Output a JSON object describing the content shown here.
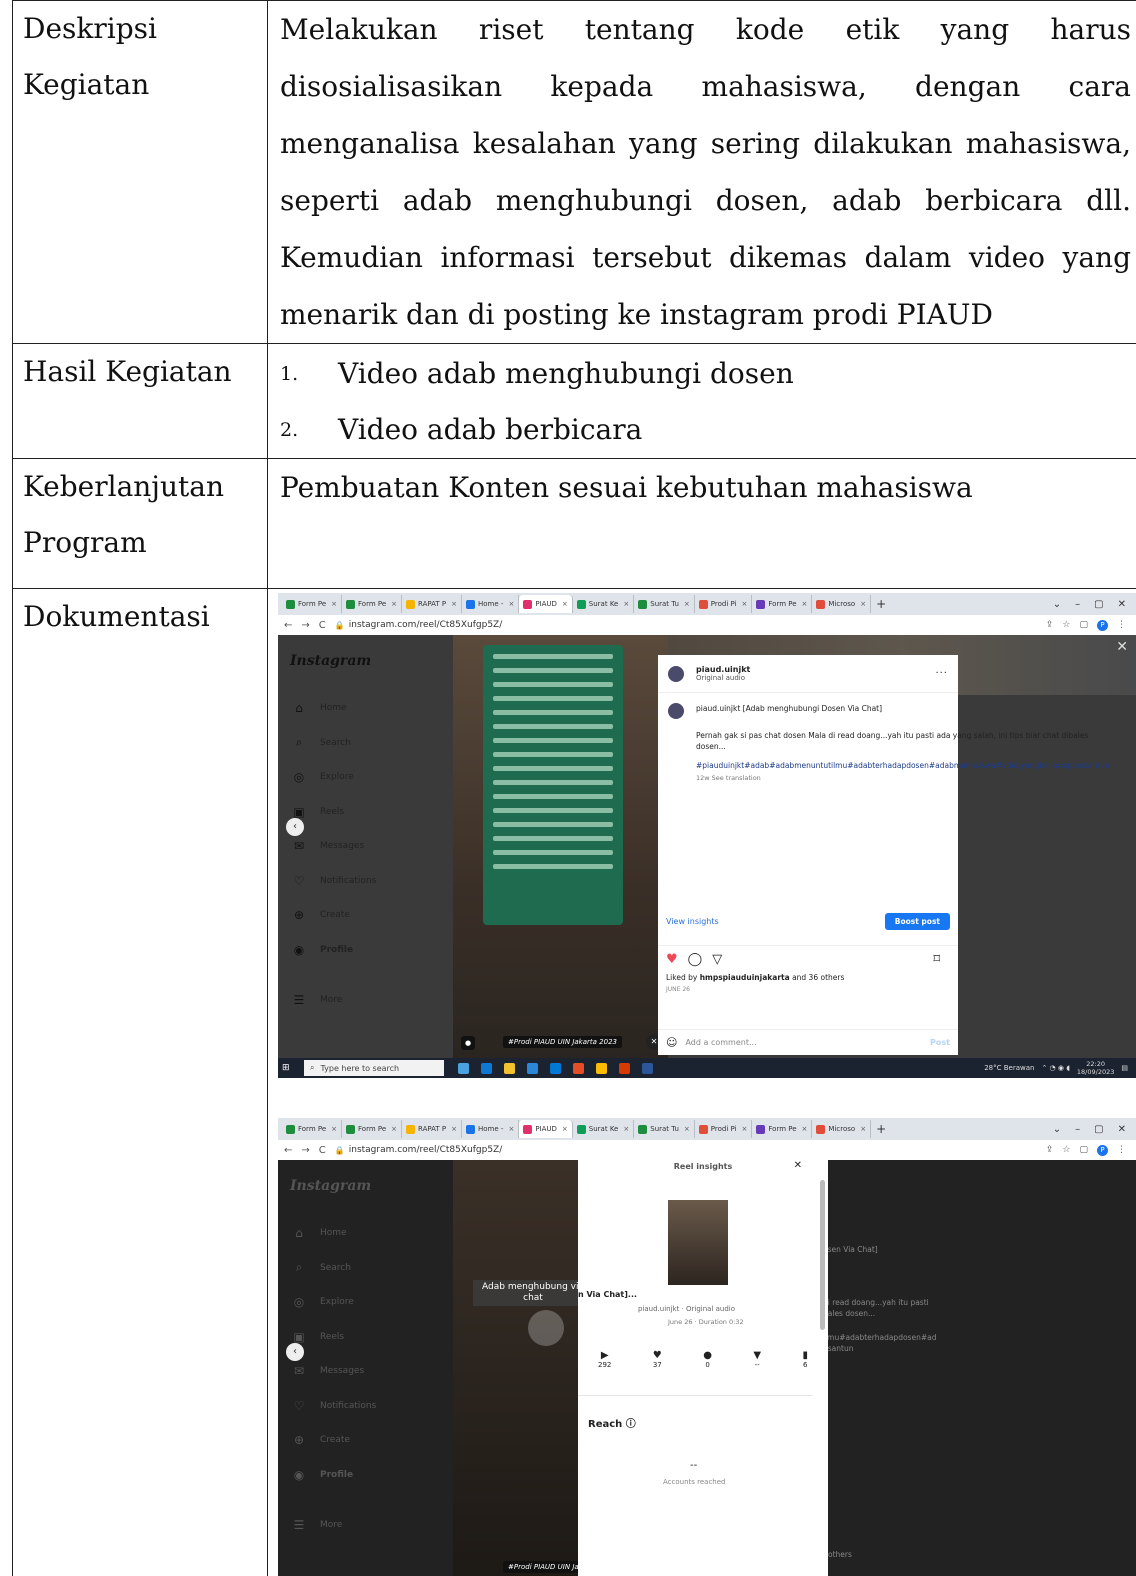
{
  "table": {
    "rows": [
      {
        "label": "Deskripsi Kegiatan",
        "content": "Melakukan riset tentang kode etik yang harus disosialisasikan kepada mahasiswa, dengan cara menganalisa kesalahan yang sering dilakukan mahasiswa, seperti adab menghubungi dosen, adab berbicara dll. Kemudian informasi tersebut dikemas dalam video yang menarik dan di posting ke instagram prodi PIAUD"
      },
      {
        "label": "Hasil Kegiatan",
        "items": [
          {
            "num": "1.",
            "text": "Video adab menghubungi dosen"
          },
          {
            "num": "2.",
            "text": "Video adab berbicara"
          }
        ]
      },
      {
        "label_line1": "Keberlanjutan",
        "label_line2": "Program",
        "content": "Pembuatan Konten sesuai kebutuhan mahasiswa"
      },
      {
        "label": "Dokumentasi"
      }
    ]
  },
  "screenshot": {
    "tabs": [
      "Form Pe",
      "Form Pe",
      "RAPAT P",
      "Home -",
      "PIAUD",
      "Surat Ke",
      "Surat Tu",
      "Prodi Pi",
      "Form Pe",
      "Microso"
    ],
    "tab_colors": [
      "#1e8e3e",
      "#1e8e3e",
      "#f4b400",
      "#1a73e8",
      "#e1306c",
      "#0f9d58",
      "#1e8e3e",
      "#e04e39",
      "#673ab7",
      "#e04e39"
    ],
    "active_tab": 4,
    "new_tab": "+",
    "url": "instagram.com/reel/Ct85Xufgp5Z/",
    "profile_letter": "P",
    "instagram": {
      "logo": "Instagram",
      "nav": [
        {
          "icon": "⌂",
          "label": "Home"
        },
        {
          "icon": "⌕",
          "label": "Search"
        },
        {
          "icon": "◎",
          "label": "Explore"
        },
        {
          "icon": "▣",
          "label": "Reels"
        },
        {
          "icon": "✉",
          "label": "Messages"
        },
        {
          "icon": "♡",
          "label": "Notifications"
        },
        {
          "icon": "⊕",
          "label": "Create"
        },
        {
          "icon": "◉",
          "label": "Profile"
        },
        {
          "icon": "☰",
          "label": "More"
        }
      ],
      "video_label": "#Prodi PIAUD UIN Jakarta 2023",
      "post": {
        "user": "piaud.uinjkt",
        "audio": "Original audio",
        "caption_title": "piaud.uinjkt [Adab menghubungi Dosen Via Chat]",
        "caption_text": "Pernah gak si pas chat dosen Mala di read doang...yah itu pasti ada yang salah, ini tips biar chat dibales dosen...",
        "caption_tags": "#piauduinjkt#adab#adabmenuntutilmu#adabterhadapdosen#adabmahasiswa#adabyangbaik#sopansantun",
        "caption_meta": "12w  See translation",
        "view_insights": "View insights",
        "boost_post": "Boost post",
        "liked_prefix": "Liked by",
        "liked_user": "hmpspiauduinjakarta",
        "liked_suffix": "and 36 others",
        "date": "JUNE 26",
        "comment_placeholder": "Add a comment...",
        "post_btn": "Post"
      }
    },
    "taskbar": {
      "search": "Type here to search",
      "weather": "28°C  Berawan",
      "time": "22:20",
      "date": "18/09/2023"
    }
  },
  "insights": {
    "title": "Reel insights",
    "video_title": "Adab menghubung via chat",
    "caption": "n Via Chat]...",
    "audio": "piaud.uinjkt · Original audio",
    "date": "June 26 · Duration 0:32",
    "stats": [
      {
        "icon": "▶",
        "value": "292"
      },
      {
        "icon": "♥",
        "value": "37"
      },
      {
        "icon": "●",
        "value": "0"
      },
      {
        "icon": "▼",
        "value": "--"
      },
      {
        "icon": "▮",
        "value": "6"
      }
    ],
    "reach_label": "Reach",
    "reach_value": "--",
    "reach_caption": "Accounts reached",
    "side_caption": "osen Via Chat]",
    "side_text1": "di read doang...yah itu pasti",
    "side_text2": "bales dosen...",
    "side_tags1": "ilmu#adabterhadapdosen#ad",
    "side_tags2": "nsantun",
    "side_others": "others"
  }
}
